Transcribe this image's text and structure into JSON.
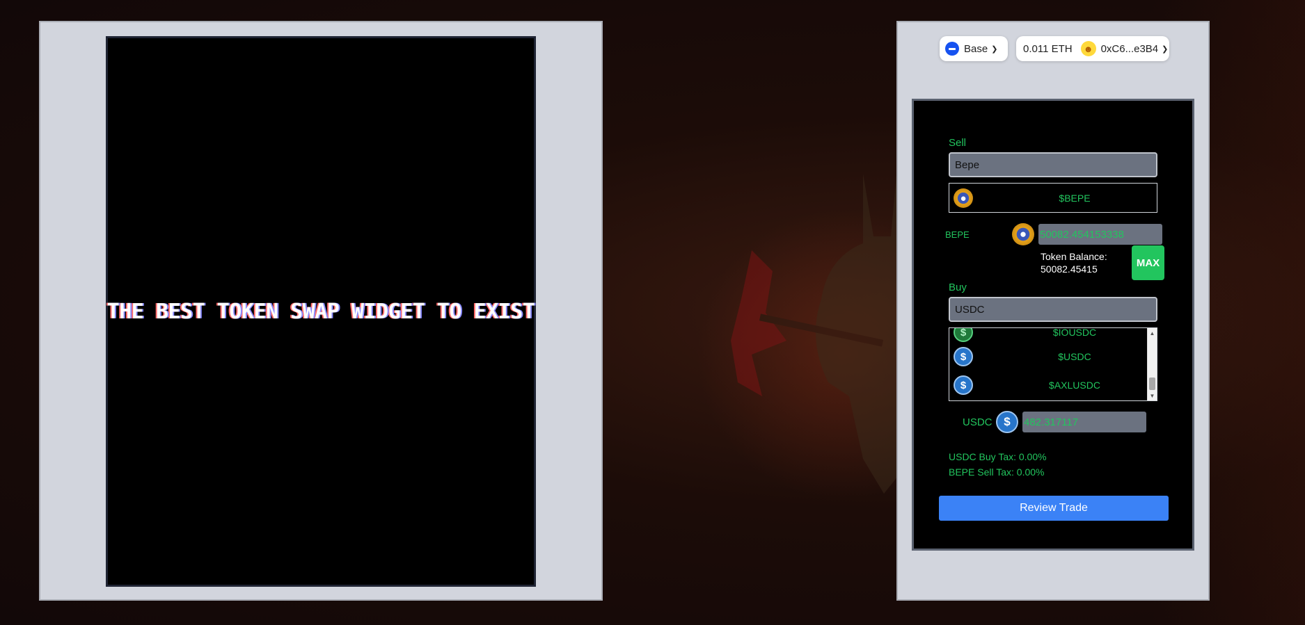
{
  "hero": {
    "tagline": "THE BEST TOKEN SWAP WIDGET TO EXIST"
  },
  "header": {
    "network": {
      "label": "Base",
      "icon": "base-network-icon"
    },
    "wallet": {
      "balance": "0.011 ETH",
      "address": "0xC6...e3B4",
      "avatar_icon": "wallet-avatar-icon"
    }
  },
  "swap": {
    "sell": {
      "label": "Sell",
      "search_value": "Bepe",
      "results": [
        {
          "symbol": "$BEPE",
          "icon": "bepe-token-icon"
        }
      ],
      "token_symbol": "BEPE",
      "amount": "50082.454153338",
      "balance_label": "Token Balance:",
      "balance_value": "50082.45415",
      "max_label": "MAX"
    },
    "buy": {
      "label": "Buy",
      "search_value": "USDC",
      "results": [
        {
          "symbol": "$IOUSDC",
          "icon": "iousdc-token-icon"
        },
        {
          "symbol": "$USDC",
          "icon": "usdc-token-icon"
        },
        {
          "symbol": "$AXLUSDC",
          "icon": "axlusdc-token-icon"
        }
      ],
      "token_symbol": "USDC",
      "amount": "482.317117"
    },
    "taxes": {
      "buy": "USDC Buy Tax: 0.00%",
      "sell": "BEPE Sell Tax: 0.00%"
    },
    "review_label": "Review Trade"
  },
  "colors": {
    "accent_green": "#22c55e",
    "button_blue": "#3b82f6"
  }
}
